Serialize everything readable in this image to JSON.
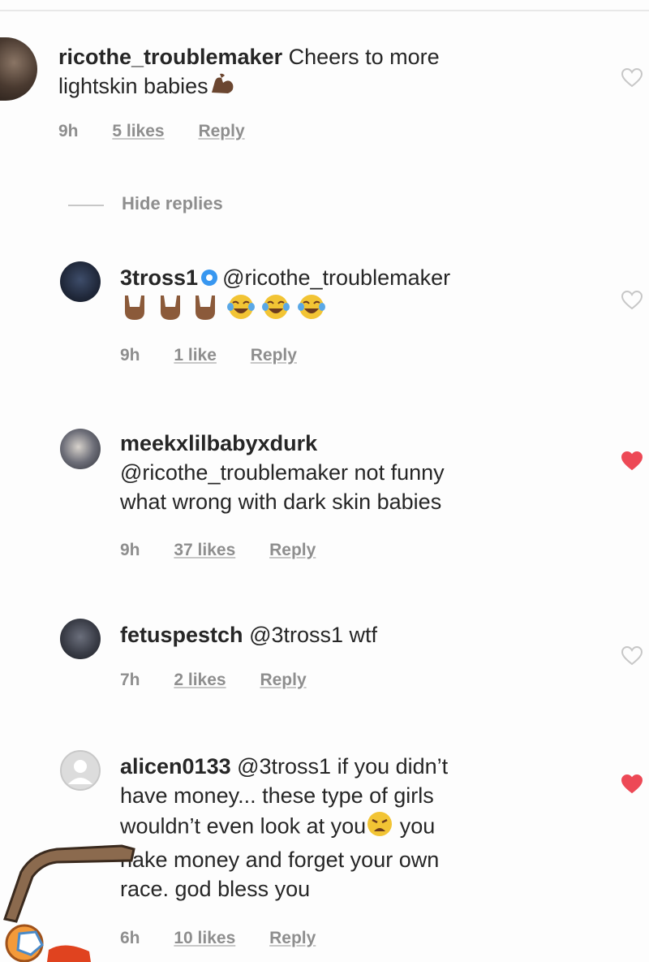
{
  "comments": [
    {
      "username": "ricothe_troublemaker",
      "text": "Cheers to more",
      "text2": "lightskin babies",
      "time": "9h",
      "likes": "5 likes",
      "reply": "Reply",
      "liked": false
    },
    {
      "username": "3tross1",
      "mention": "@ricothe_troublemaker",
      "time": "9h",
      "likes": "1 like",
      "reply": "Reply",
      "liked": false
    },
    {
      "username": "meekxlilbabyxdurk",
      "line1": "@ricothe_troublemaker  not funny",
      "line2": "what wrong with dark skin babies",
      "time": "9h",
      "likes": "37 likes",
      "reply": "Reply",
      "liked": true
    },
    {
      "username": "fetuspestch",
      "text": "@3tross1 wtf",
      "time": "7h",
      "likes": "2 likes",
      "reply": "Reply",
      "liked": false
    },
    {
      "username": "alicen0133",
      "line1": "@3tross1 if you didn’t",
      "line2": "have money... these type of girls",
      "line3a": "wouldn’t even look at you",
      "line3b": " you",
      "line4": "hake money and forget your own",
      "line5": "race. god bless you",
      "time": "6h",
      "likes": "10 likes",
      "reply": "Reply",
      "liked": true
    }
  ],
  "hide_replies": "Hide replies",
  "colors": {
    "text": "#262626",
    "meta": "#8e8e8e",
    "heart_liked": "#ed4956",
    "heart_outline": "#c7c7c7",
    "verified": "#3897f0"
  },
  "icons": [
    "heart-outline-icon",
    "heart-filled-icon",
    "verified-badge-icon",
    "flexed-biceps-emoji",
    "sign-of-horns-emoji",
    "tears-of-joy-emoji",
    "weary-face-emoji"
  ]
}
